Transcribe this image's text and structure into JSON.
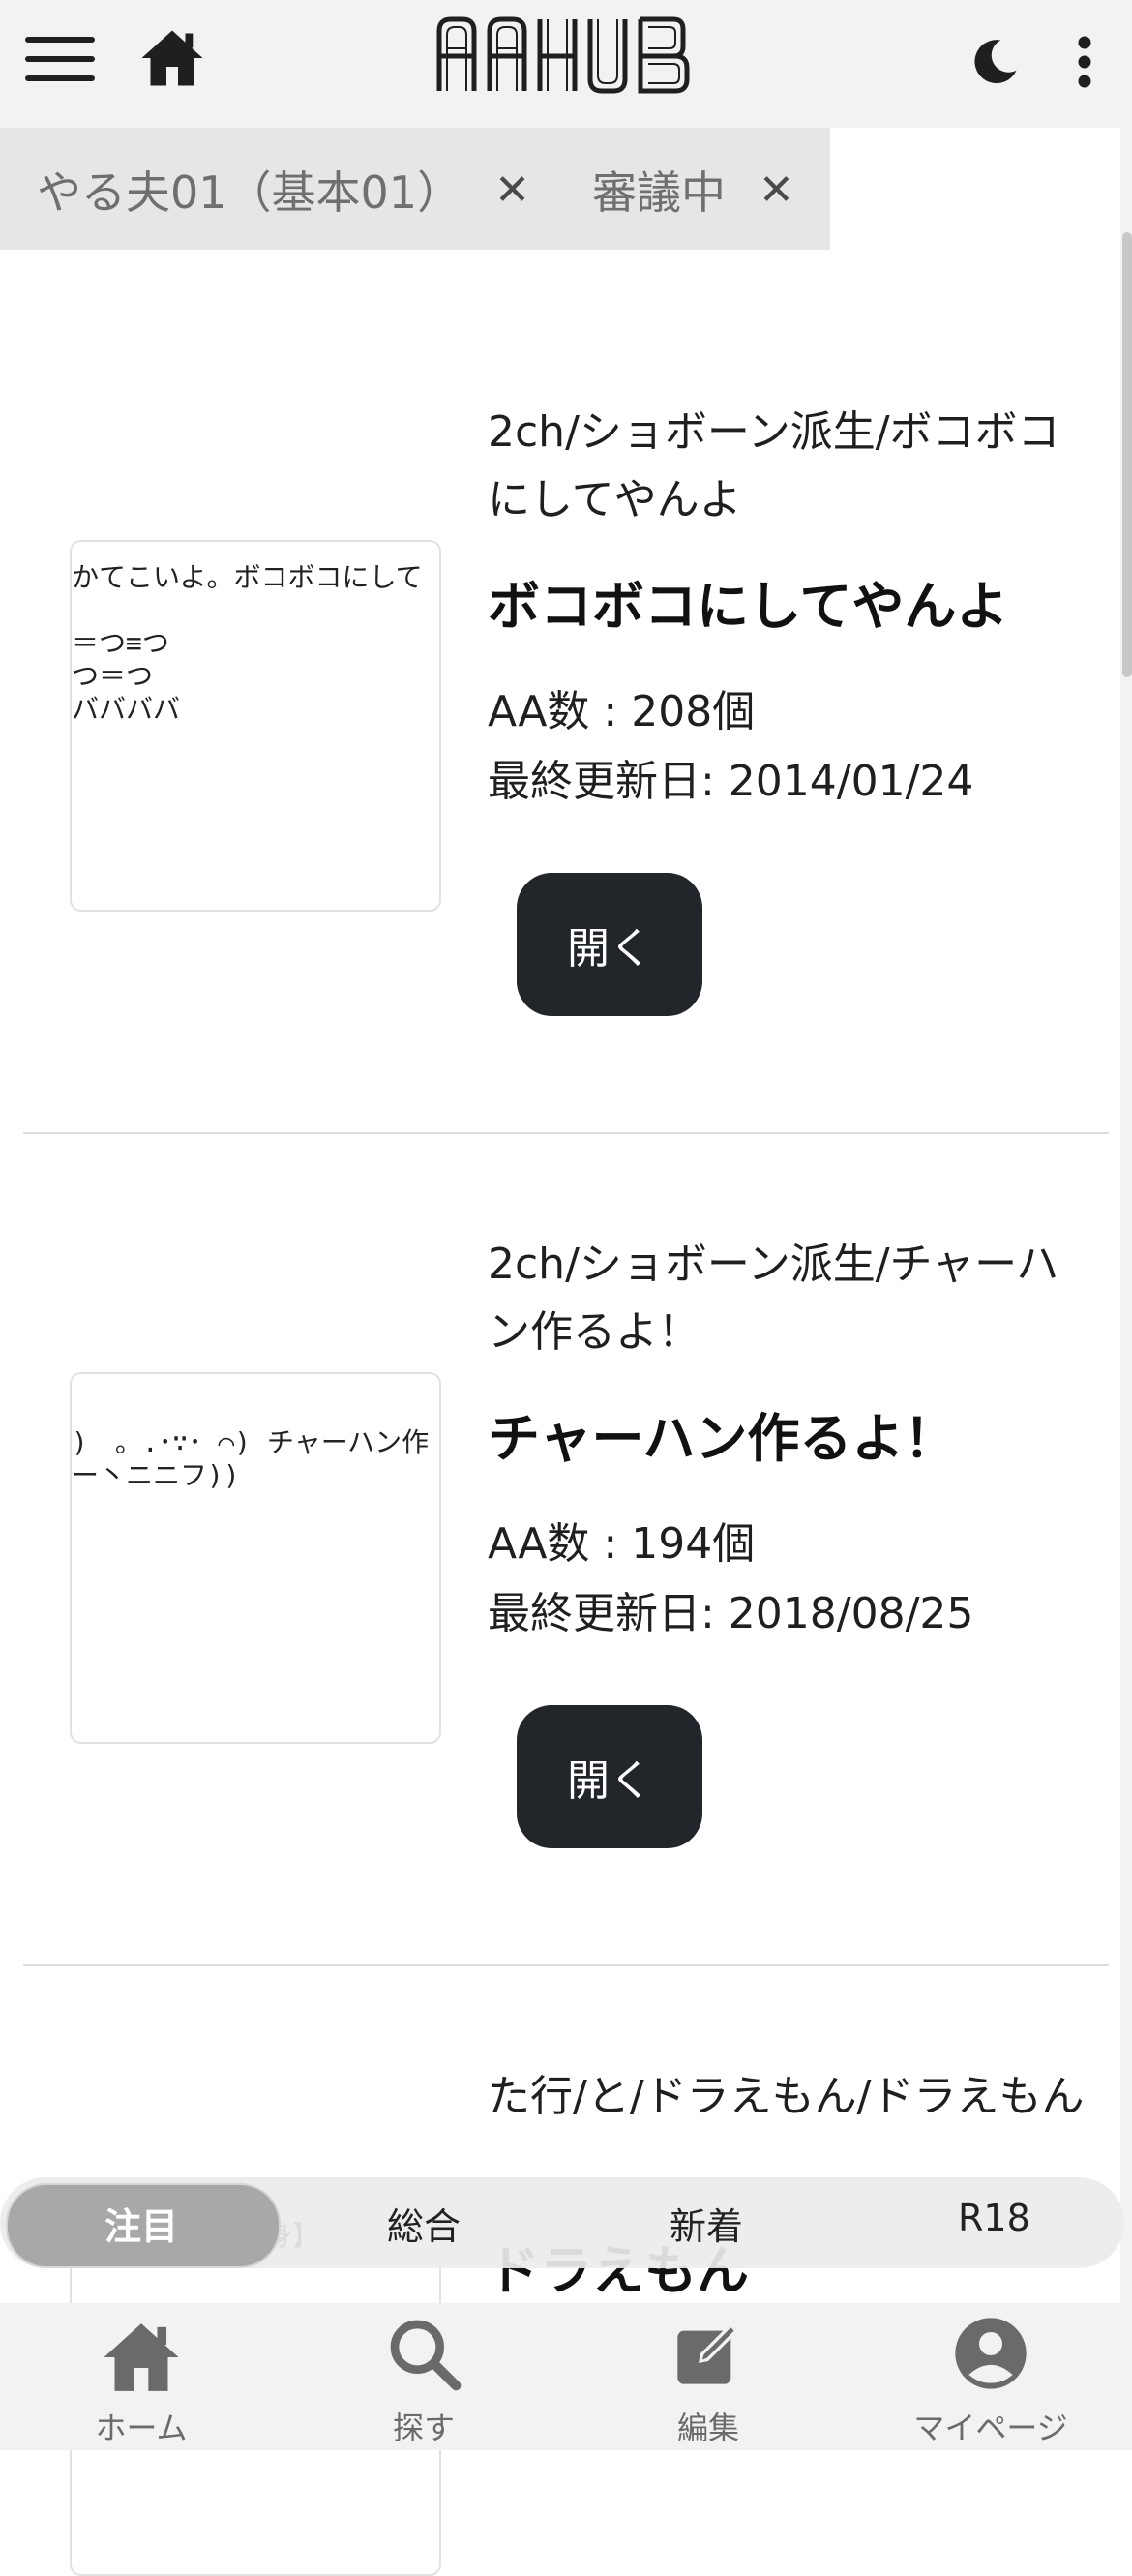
{
  "header": {
    "logo_text": "AAHUB",
    "menu_icon": "hamburger-icon",
    "home_icon": "home-icon",
    "theme_icon": "moon-icon",
    "more_icon": "more-vertical-icon"
  },
  "filters": [
    {
      "label": "やる夫01（基本01）",
      "remove": "✕"
    },
    {
      "label": "審議中",
      "remove": "✕"
    }
  ],
  "cards": [
    {
      "category": "2ch/ショボーン派生/ボコボコにしてやんよ",
      "title": "ボコボコにしてやんよ",
      "count": "AA数 : 208個",
      "updated": "最終更新日: 2014/01/24",
      "open_label": "開く",
      "preview": "かてこいよ。ボコボコにして\n\n＝つ≡つ\nつ＝つ\nババババ"
    },
    {
      "category": "2ch/ショボーン派生/チャーハン作るよ！",
      "title": "チャーハン作るよ！",
      "count": "AA数 : 194個",
      "updated": "最終更新日: 2018/08/25",
      "open_label": "開く",
      "preview": ")　。.･∵･ ⌒) チャーハン作\nー丶ニニフ))"
    },
    {
      "category": "た行/と/ドラえもん/ドラえもん",
      "title": "ドラえもん",
      "preview": "身】"
    }
  ],
  "segments": [
    {
      "label": "注目",
      "active": true
    },
    {
      "label": "総合",
      "active": false
    },
    {
      "label": "新着",
      "active": false
    },
    {
      "label": "R18",
      "active": false
    }
  ],
  "bottom_nav": [
    {
      "label": "ホーム",
      "icon": "home-icon"
    },
    {
      "label": "探す",
      "icon": "search-icon"
    },
    {
      "label": "編集",
      "icon": "edit-icon"
    },
    {
      "label": "マイページ",
      "icon": "account-icon"
    }
  ],
  "colors": {
    "button_dark": "#22252a",
    "bar_background": "#f2f2f2",
    "chip_background": "#e6e6e6",
    "segment_active": "#a8a8a8"
  }
}
